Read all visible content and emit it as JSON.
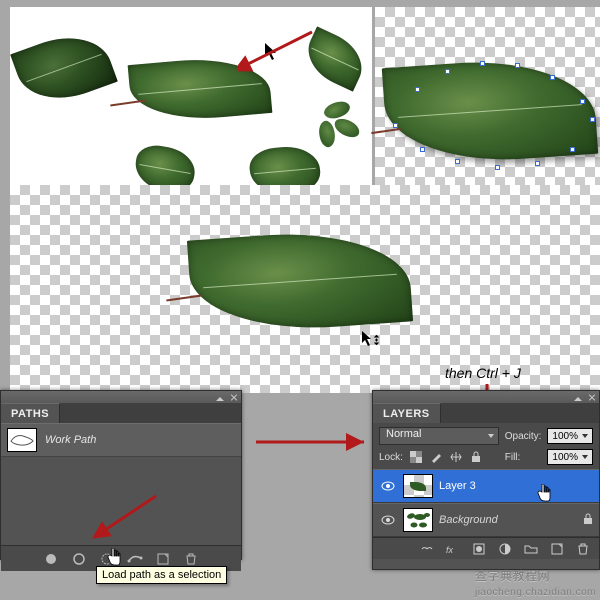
{
  "note_text": "then Ctrl + J",
  "tooltip": "Load path as a selection",
  "watermark_cn": "查字典教程网",
  "watermark_url": "jiaocheng.chazidian.com",
  "paths_panel": {
    "tab": "PATHS",
    "row_label": "Work Path",
    "footer_icons": [
      "fill-path-icon",
      "stroke-path-icon",
      "load-selection-icon",
      "make-work-path-icon",
      "new-path-icon",
      "delete-path-icon"
    ]
  },
  "layers_panel": {
    "tab": "LAYERS",
    "blend_mode": "Normal",
    "opacity_label": "Opacity:",
    "opacity_value": "100%",
    "lock_label": "Lock:",
    "fill_label": "Fill:",
    "fill_value": "100%",
    "layers": [
      {
        "name": "Layer 3",
        "selected": true,
        "italic": false,
        "locked": false
      },
      {
        "name": "Background",
        "selected": false,
        "italic": true,
        "locked": true
      }
    ],
    "footer_icons": [
      "link-layers-icon",
      "fx-icon",
      "mask-icon",
      "adjustment-icon",
      "group-icon",
      "new-layer-icon",
      "delete-layer-icon"
    ]
  }
}
